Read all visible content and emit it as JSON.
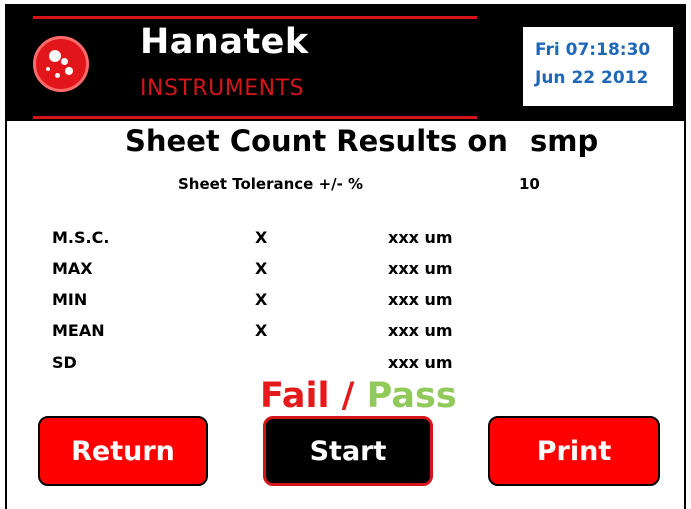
{
  "header": {
    "brand": "Hanatek",
    "sub_brand": "INSTRUMENTS",
    "datetime_line1": "Fri 07:18:30",
    "datetime_line2": "Jun 22 2012"
  },
  "main": {
    "title": "Sheet Count Results on",
    "sample": "smp",
    "tolerance_label": "Sheet Tolerance +/- %",
    "tolerance_value": "10",
    "results": [
      {
        "label": "M.S.C.",
        "value": "X",
        "unit": "xxx um"
      },
      {
        "label": "MAX",
        "value": "X",
        "unit": "xxx um"
      },
      {
        "label": "MIN",
        "value": "X",
        "unit": "xxx um"
      },
      {
        "label": "MEAN",
        "value": "X",
        "unit": "xxx um"
      },
      {
        "label": "SD",
        "value": "",
        "unit": "xxx um"
      }
    ],
    "status_fail": "Fail",
    "status_separator": "/",
    "status_pass": "Pass"
  },
  "buttons": {
    "return": "Return",
    "start": "Start",
    "print": "Print"
  },
  "colors": {
    "accent_red": "#d4141b",
    "button_red": "#ff0000",
    "pass_green": "#92c95b",
    "date_blue": "#1f68b8"
  }
}
